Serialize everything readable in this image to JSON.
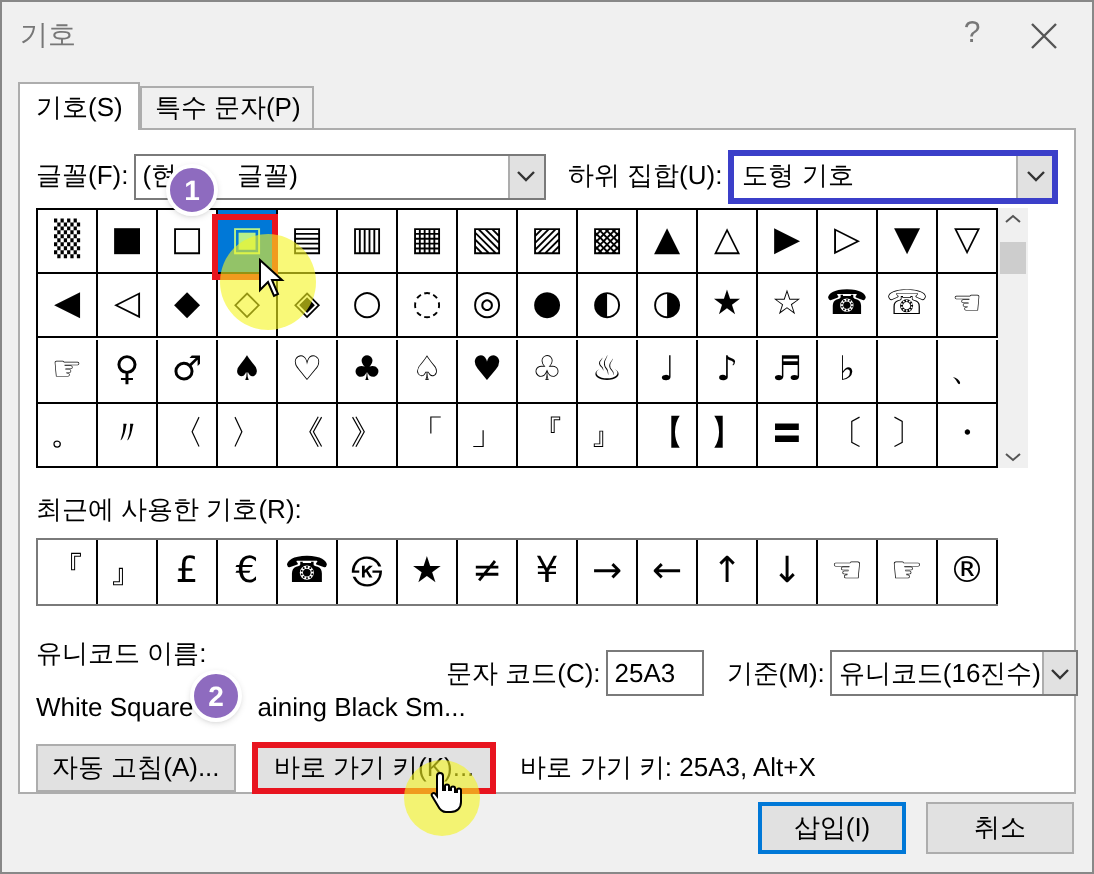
{
  "window": {
    "title": "기호",
    "help": "?"
  },
  "tabs": [
    {
      "label": "기호(S)",
      "selected": true
    },
    {
      "label": "특수 문자(P)",
      "selected": false
    }
  ],
  "font": {
    "label": "글꼴(F):",
    "value_parts": [
      "(현",
      "글꼴)"
    ]
  },
  "subset": {
    "label": "하위 집합(U):",
    "value": "도형 기호",
    "highlighted": true
  },
  "symbols": [
    [
      {
        "s": "▒",
        "selected": false
      },
      {
        "s": "■",
        "selected": false
      },
      {
        "s": "□",
        "selected": false
      },
      {
        "s": "▣",
        "selected": true
      },
      {
        "s": "▤",
        "selected": false
      },
      {
        "s": "▥",
        "selected": false
      },
      {
        "s": "▦",
        "selected": false
      },
      {
        "s": "▧",
        "selected": false
      },
      {
        "s": "▨",
        "selected": false
      },
      {
        "s": "▩",
        "selected": false
      },
      {
        "s": "▲",
        "selected": false
      },
      {
        "s": "△",
        "selected": false
      },
      {
        "s": "▶",
        "selected": false
      },
      {
        "s": "▷",
        "selected": false
      },
      {
        "s": "▼",
        "selected": false
      },
      {
        "s": "▽",
        "selected": false
      }
    ],
    [
      {
        "s": "◀",
        "selected": false
      },
      {
        "s": "◁",
        "selected": false
      },
      {
        "s": "◆",
        "selected": false
      },
      {
        "s": "◇",
        "selected": false
      },
      {
        "s": "◈",
        "selected": false
      },
      {
        "s": "○",
        "selected": false
      },
      {
        "s": "◌",
        "selected": false
      },
      {
        "s": "◎",
        "selected": false
      },
      {
        "s": "●",
        "selected": false
      },
      {
        "s": "◐",
        "selected": false
      },
      {
        "s": "◑",
        "selected": false
      },
      {
        "s": "★",
        "selected": false
      },
      {
        "s": "☆",
        "selected": false
      },
      {
        "s": "☎",
        "selected": false
      },
      {
        "s": "☏",
        "selected": false
      },
      {
        "s": "☜",
        "selected": false
      }
    ],
    [
      {
        "s": "☞",
        "selected": false
      },
      {
        "s": "♀",
        "selected": false
      },
      {
        "s": "♂",
        "selected": false
      },
      {
        "s": "♠",
        "selected": false
      },
      {
        "s": "♡",
        "selected": false
      },
      {
        "s": "♣",
        "selected": false
      },
      {
        "s": "♤",
        "selected": false
      },
      {
        "s": "♥",
        "selected": false
      },
      {
        "s": "♧",
        "selected": false
      },
      {
        "s": "♨",
        "selected": false
      },
      {
        "s": "♩",
        "selected": false
      },
      {
        "s": "♪",
        "selected": false
      },
      {
        "s": "♬",
        "selected": false
      },
      {
        "s": "♭",
        "selected": false
      },
      {
        "selected": false
      },
      {
        "s": "、",
        "selected": false
      }
    ],
    [
      {
        "s": "。",
        "selected": false
      },
      {
        "s": "〃",
        "selected": false
      },
      {
        "s": "〈",
        "selected": false
      },
      {
        "s": "〉",
        "selected": false
      },
      {
        "s": "《",
        "selected": false
      },
      {
        "s": "》",
        "selected": false
      },
      {
        "s": "「",
        "selected": false
      },
      {
        "s": "」",
        "selected": false
      },
      {
        "s": "『",
        "selected": false
      },
      {
        "s": "』",
        "selected": false
      },
      {
        "s": "【",
        "selected": false
      },
      {
        "s": "】",
        "selected": false
      },
      {
        "s": "〓",
        "selected": false
      },
      {
        "s": "〔",
        "selected": false
      },
      {
        "s": "〕",
        "selected": false
      },
      {
        "s": "・",
        "selected": false
      }
    ]
  ],
  "recent": {
    "label": "최근에 사용한 기호(R):",
    "symbols": [
      "『",
      "』",
      "£",
      "€",
      "☎",
      "㉿",
      "★",
      "≠",
      "¥",
      "→",
      "←",
      "↑",
      "↓",
      "☜",
      "☞",
      "®"
    ]
  },
  "unicode_name": {
    "label": "유니코드 이름:",
    "value_parts": [
      "White Square",
      "aining Black Sm..."
    ]
  },
  "char_code": {
    "label": "문자 코드(C):",
    "value": "25A3"
  },
  "from": {
    "label": "기준(M):",
    "value": "유니코드(16진수)"
  },
  "autocorrect_button": "자동 고침(A)...",
  "shortcut_button": {
    "label": "바로 가기 키(K)...",
    "highlighted": true
  },
  "shortcut_text": "바로 가기 키: 25A3, Alt+X",
  "buttons": [
    {
      "label": "삽입(I)",
      "default": true
    },
    {
      "label": "취소",
      "default": false
    }
  ],
  "badges": [
    "1",
    "2"
  ]
}
